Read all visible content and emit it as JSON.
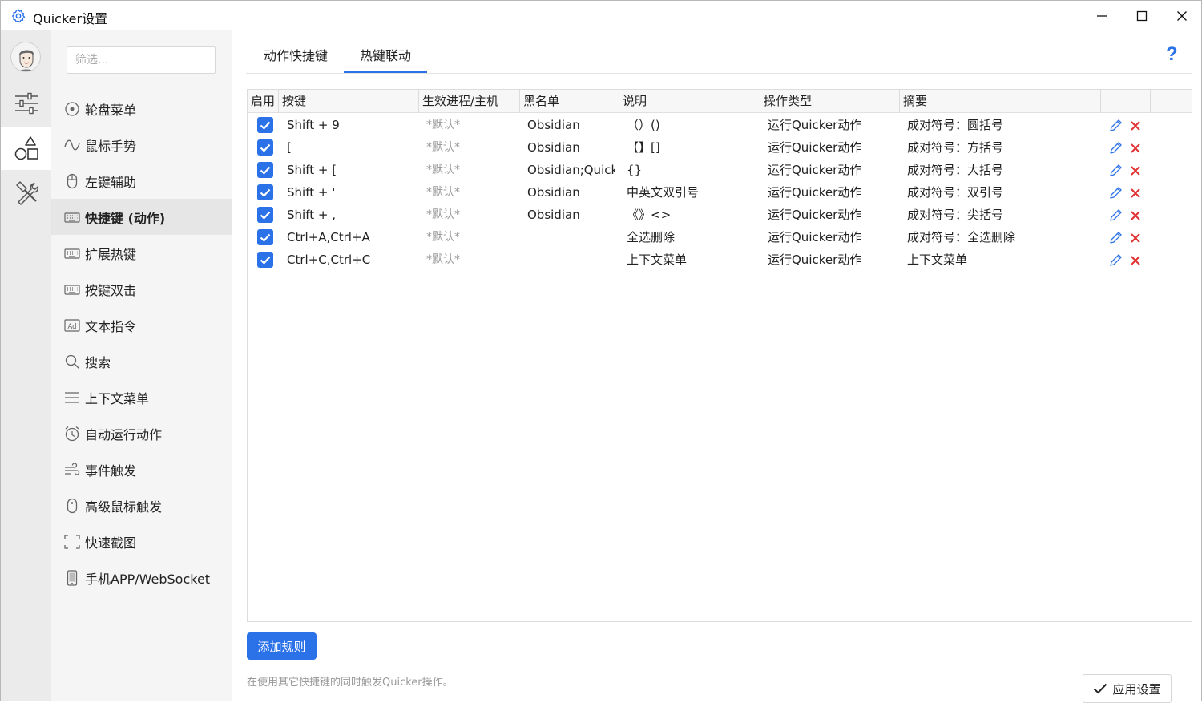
{
  "window": {
    "title": "Quicker设置"
  },
  "nav": {
    "filter_placeholder": "筛选...",
    "items": [
      {
        "label": "轮盘菜单",
        "icon": "circle-dot-icon"
      },
      {
        "label": "鼠标手势",
        "icon": "wave-icon"
      },
      {
        "label": "左键辅助",
        "icon": "mouse-icon"
      },
      {
        "label": "快捷键 (动作)",
        "icon": "keyboard-icon"
      },
      {
        "label": "扩展热键",
        "icon": "keyboard-icon"
      },
      {
        "label": "按键双击",
        "icon": "keyboard-icon"
      },
      {
        "label": "文本指令",
        "icon": "ad-icon"
      },
      {
        "label": "搜索",
        "icon": "search-icon"
      },
      {
        "label": "上下文菜单",
        "icon": "menu-icon"
      },
      {
        "label": "自动运行动作",
        "icon": "alarm-icon"
      },
      {
        "label": "事件触发",
        "icon": "wind-icon"
      },
      {
        "label": "高级鼠标触发",
        "icon": "mouse-icon"
      },
      {
        "label": "快速截图",
        "icon": "crop-icon"
      },
      {
        "label": "手机APP/WebSocket",
        "icon": "phone-icon"
      }
    ]
  },
  "tabs": [
    {
      "label": "动作快捷键"
    },
    {
      "label": "热键联动"
    }
  ],
  "help": "?",
  "table": {
    "headers": [
      "启用",
      "按键",
      "生效进程/主机",
      "黑名单",
      "说明",
      "操作类型",
      "摘要"
    ],
    "rows": [
      {
        "key": "Shift + 9",
        "process": "*默认*",
        "blacklist": "Obsidian",
        "desc": "（）()",
        "type": "运行Quicker动作",
        "summary": "成对符号：圆括号"
      },
      {
        "key": "[",
        "process": "*默认*",
        "blacklist": "Obsidian",
        "desc": "【】[]",
        "type": "运行Quicker动作",
        "summary": "成对符号：方括号"
      },
      {
        "key": "Shift + [",
        "process": "*默认*",
        "blacklist": "Obsidian;Quicker",
        "desc": "{}",
        "type": "运行Quicker动作",
        "summary": "成对符号：大括号"
      },
      {
        "key": "Shift + '",
        "process": "*默认*",
        "blacklist": "Obsidian",
        "desc": "中英文双引号",
        "type": "运行Quicker动作",
        "summary": "成对符号：双引号"
      },
      {
        "key": "Shift + ,",
        "process": "*默认*",
        "blacklist": "Obsidian",
        "desc": "《》<>",
        "type": "运行Quicker动作",
        "summary": "成对符号：尖括号"
      },
      {
        "key": "Ctrl+A,Ctrl+A",
        "process": "*默认*",
        "blacklist": "",
        "desc": "全选删除",
        "type": "运行Quicker动作",
        "summary": "成对符号：全选删除"
      },
      {
        "key": "Ctrl+C,Ctrl+C",
        "process": "*默认*",
        "blacklist": "",
        "desc": "上下文菜单",
        "type": "运行Quicker动作",
        "summary": "上下文菜单"
      }
    ]
  },
  "add_rule": "添加规则",
  "footnote": "在使用其它快捷键的同时触发Quicker操作。",
  "apply": "应用设置",
  "colors": {
    "accent": "#2b72e8",
    "delete": "#e03030"
  }
}
